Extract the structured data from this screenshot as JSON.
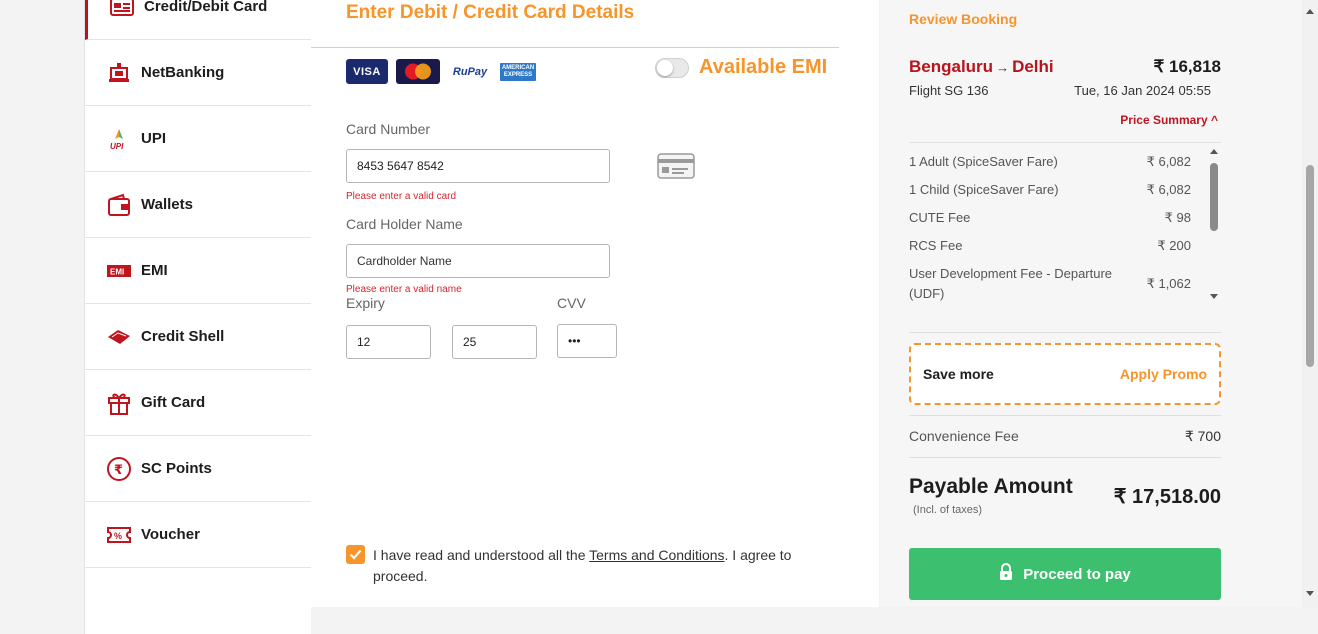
{
  "menu": {
    "items": [
      {
        "label": "Credit/Debit Card",
        "icon": "card-icon",
        "active": true
      },
      {
        "label": "NetBanking",
        "icon": "bank-icon"
      },
      {
        "label": "UPI",
        "icon": "upi-icon"
      },
      {
        "label": "Wallets",
        "icon": "wallet-icon"
      },
      {
        "label": "EMI",
        "icon": "emi-icon"
      },
      {
        "label": "Credit Shell",
        "icon": "credit-shell-icon"
      },
      {
        "label": "Gift Card",
        "icon": "gift-icon"
      },
      {
        "label": "SC Points",
        "icon": "rupee-icon"
      },
      {
        "label": "Voucher",
        "icon": "voucher-icon"
      }
    ]
  },
  "form": {
    "title": "Enter Debit / Credit Card Details",
    "logos": {
      "visa": "VISA",
      "mastercard": "MasterCard",
      "rupay": "RuPay",
      "amex": "AMERICAN EXPRESS"
    },
    "emi_label": "Available EMI",
    "emi_enabled": false,
    "card_number_label": "Card Number",
    "card_number_value": "8453 5647 8542",
    "card_number_error": "Please enter a valid card",
    "holder_label": "Card Holder Name",
    "holder_placeholder": "Cardholder Name",
    "holder_error": "Please enter a valid name",
    "expiry_label": "Expiry",
    "expiry_month": "12",
    "expiry_year": "25",
    "cvv_label": "CVV",
    "cvv_value": "•••",
    "terms_prefix": "I have read and understood all the ",
    "terms_link": "Terms and Conditions",
    "terms_suffix": ". I agree to proceed.",
    "terms_checked": true
  },
  "summary": {
    "review_label": "Review Booking",
    "origin": "Bengaluru",
    "arrow": "→",
    "destination": "Delhi",
    "total_top": "₹ 16,818",
    "flight": "Flight  SG 136",
    "date": "Tue, 16 Jan 2024 05:55",
    "price_summary_label": "Price Summary ^",
    "breakup": [
      {
        "label": "1 Adult  (SpiceSaver Fare)",
        "amount": "₹ 6,082"
      },
      {
        "label": "1 Child  (SpiceSaver Fare)",
        "amount": "₹ 6,082"
      },
      {
        "label": "CUTE Fee",
        "amount": "₹ 98"
      },
      {
        "label": "RCS Fee",
        "amount": "₹ 200"
      },
      {
        "label": "User Development Fee - Departure (UDF)",
        "amount": "₹ 1,062"
      }
    ],
    "promo_left": "Save more",
    "promo_right": "Apply Promo",
    "convenience_label": "Convenience Fee",
    "convenience_amount": "₹ 700",
    "payable_label": "Payable Amount",
    "payable_sub": "(Incl. of taxes)",
    "payable_amount": "₹ 17,518.00",
    "pay_button": "Proceed to pay"
  },
  "colors": {
    "accent": "#f7942a",
    "brand_red": "#b8141d",
    "pay_green": "#3dbf70"
  }
}
